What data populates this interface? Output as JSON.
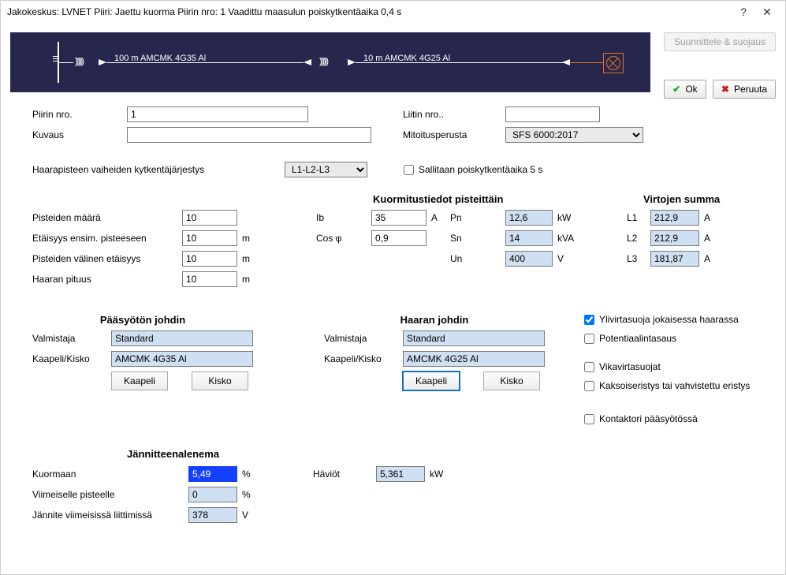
{
  "title": "Jakokeskus: LVNET    Piiri: Jaettu kuorma    Piirin nro: 1  Vaadittu maasulun poiskytkentäaika 0,4 s",
  "window": {
    "help": "?",
    "close": "✕"
  },
  "buttons": {
    "design": "Suunnittele & suojaus",
    "ok": "Ok",
    "cancel": "Peruuta"
  },
  "diagram": {
    "cable1": "100 m  AMCMK 4G35 Al",
    "cable2": "10 m  AMCMK 4G25 Al"
  },
  "labels": {
    "circuit_no": "Piirin nro.",
    "description": "Kuvaus",
    "terminal_no": "Liitin nro..",
    "dimensioning": "Mitoitusperusta",
    "phase_order": "Haarapisteen vaiheiden kytkentäjärjestys",
    "allow_5s": "Sallitaan poiskytkentäaika 5 s",
    "load_header": "Kuormitustiedot pisteittäin",
    "currents_header": "Virtojen summa",
    "point_count": "Pisteiden määrä",
    "dist_first": "Etäisyys ensim. pisteeseen",
    "dist_between": "Pisteiden välinen etäisyys",
    "branch_len": "Haaran pituus",
    "Ib": "Ib",
    "cosphi": "Cos φ",
    "Pn": "Pn",
    "Sn": "Sn",
    "Un": "Un",
    "L1": "L1",
    "L2": "L2",
    "L3": "L3",
    "main_feeder": "Pääsyötön johdin",
    "branch_feeder": "Haaran johdin",
    "manufacturer": "Valmistaja",
    "cable_bus": "Kaapeli/Kisko",
    "btn_cable": "Kaapeli",
    "btn_bus": "Kisko",
    "chk_overcurrent": "Ylivirtasuoja jokaisessa haarassa",
    "chk_equipotential": "Potentiaalintasaus",
    "chk_fault": "Vikavirtasuojat",
    "chk_doubleins": "Kaksoiseristys tai vahvistettu eristys",
    "chk_contactor": "Kontaktori pääsyötössä",
    "vd_header": "Jännitteenalenema",
    "vd_load": "Kuormaan",
    "vd_last": "Viimeiselle pisteelle",
    "v_last": "Jännite viimeisissä liittimissä",
    "losses": "Häviöt"
  },
  "units": {
    "m": "m",
    "A": "A",
    "kW": "kW",
    "kVA": "kVA",
    "V": "V",
    "pct": "%"
  },
  "values": {
    "circuit_no": "1",
    "description": "",
    "terminal_no": "",
    "dimensioning": "SFS 6000:2017",
    "phase_order": "L1-L2-L3",
    "allow_5s": false,
    "point_count": "10",
    "dist_first": "10",
    "dist_between": "10",
    "branch_len": "10",
    "Ib": "35",
    "cosphi": "0,9",
    "Pn": "12,6",
    "Sn": "14",
    "Un": "400",
    "L1": "212,9",
    "L2": "212,9",
    "L3": "181,87",
    "main_manu": "Standard",
    "main_cable": "AMCMK 4G35 Al",
    "branch_manu": "Standard",
    "branch_cable": "AMCMK 4G25 Al",
    "chk_overcurrent": true,
    "chk_equipotential": false,
    "chk_fault": false,
    "chk_doubleins": false,
    "chk_contactor": false,
    "vd_load": "5,49",
    "vd_last": "0",
    "v_last": "378",
    "losses": "5,361"
  }
}
